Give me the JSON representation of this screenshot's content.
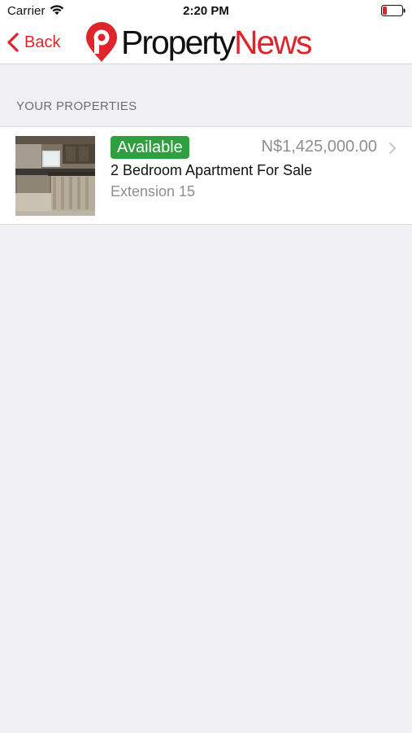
{
  "status_bar": {
    "carrier": "Carrier",
    "time": "2:20 PM",
    "battery_color": "#e0242c"
  },
  "nav": {
    "back_label": "Back",
    "logo_word_1": "Property",
    "logo_word_2": "News",
    "brand_color": "#e0242c"
  },
  "section": {
    "header": "YOUR PROPERTIES"
  },
  "properties": [
    {
      "status": "Available",
      "status_color": "#2f9e3f",
      "price": "N$1,425,000.00",
      "title": "2 Bedroom Apartment For Sale",
      "location": "Extension 15",
      "thumbnail": "kitchen-interior-photo"
    }
  ]
}
